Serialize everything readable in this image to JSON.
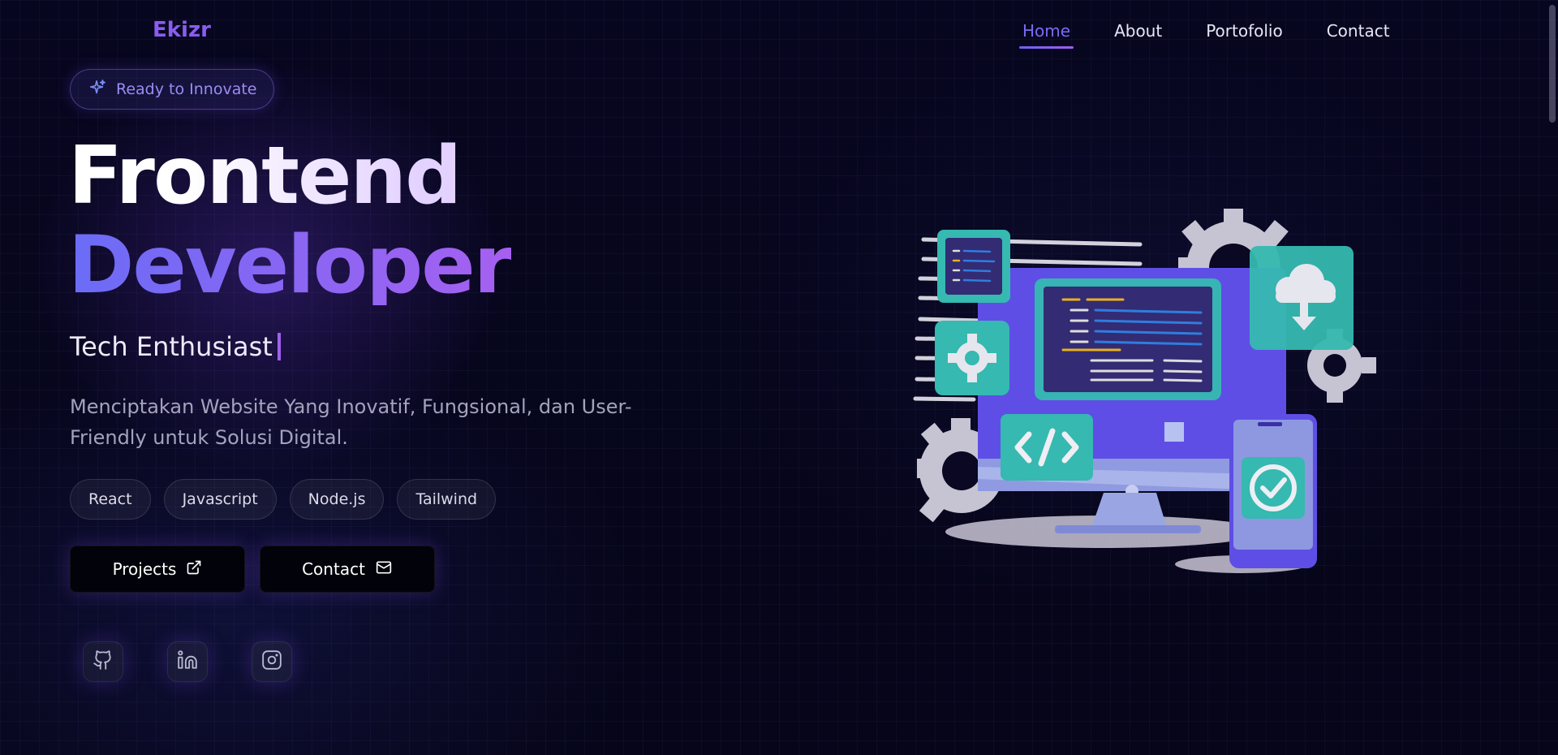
{
  "nav": {
    "logo": "Ekizr",
    "items": [
      {
        "label": "Home",
        "active": true
      },
      {
        "label": "About"
      },
      {
        "label": "Portofolio"
      },
      {
        "label": "Contact"
      }
    ]
  },
  "hero": {
    "badge": "Ready to Innovate",
    "title_line1": "Frontend",
    "title_line2": "Developer",
    "subtitle": "Tech Enthusiast",
    "description": "Menciptakan Website Yang Inovatif, Fungsional, dan User-Friendly untuk Solusi Digital.",
    "tags": [
      "React",
      "Javascript",
      "Node.js",
      "Tailwind"
    ],
    "buttons": {
      "projects": "Projects",
      "contact": "Contact"
    },
    "socials": [
      "github-icon",
      "linkedin-icon",
      "instagram-icon"
    ]
  },
  "colors": {
    "accent_blue": "#6b6cf6",
    "accent_purple": "#a660f0",
    "background": "#05041a",
    "teal": "#2fc7b2"
  }
}
